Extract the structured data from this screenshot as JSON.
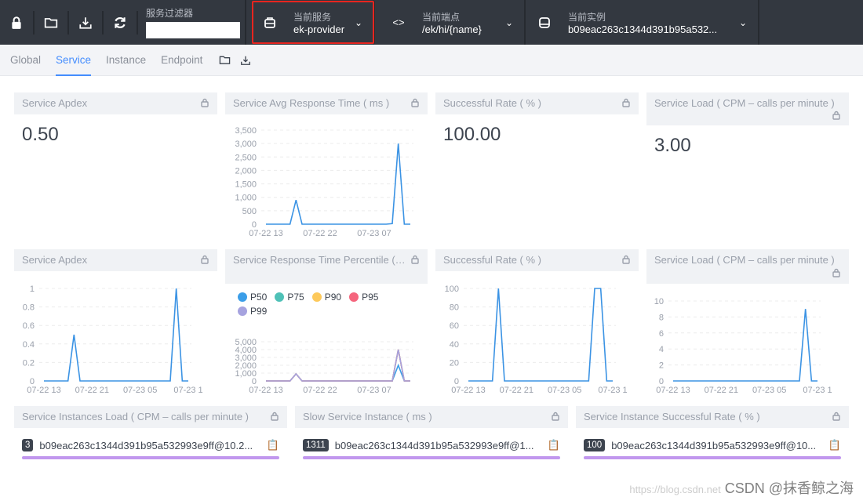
{
  "header": {
    "filter_label": "服务过滤器",
    "filter_value": "",
    "service": {
      "label": "当前服务",
      "value": "ek-provider"
    },
    "endpoint": {
      "label": "当前端点",
      "value": "/ek/hi/{name}"
    },
    "instance": {
      "label": "当前实例",
      "value": "b09eac263c1344d391b95a532..."
    },
    "icons": [
      "lock-icon",
      "folder-icon",
      "download-icon",
      "refresh-icon"
    ]
  },
  "tabs": [
    "Global",
    "Service",
    "Instance",
    "Endpoint"
  ],
  "active_tab": "Service",
  "cards": {
    "apdex": {
      "title": "Service Apdex",
      "value": "0.50"
    },
    "avg_rt": {
      "title": "Service Avg Response Time ( ms )"
    },
    "success": {
      "title": "Successful Rate ( % )",
      "value": "100.00"
    },
    "load": {
      "title": "Service Load ( CPM – calls per minute )",
      "value": "3.00"
    },
    "apdex2": {
      "title": "Service Apdex"
    },
    "percentile": {
      "title": "Service Response Time Percentile ( ms )"
    },
    "success2": {
      "title": "Successful Rate ( % )"
    },
    "load2": {
      "title": "Service Load ( CPM – calls per minute )"
    },
    "inst_load": {
      "title": "Service Instances Load ( CPM – calls per minute )",
      "badge": "3",
      "name": "b09eac263c1344d391b95a532993e9ff@10.2..."
    },
    "slow_inst": {
      "title": "Slow Service Instance ( ms )",
      "badge": "1311",
      "name": "b09eac263c1344d391b95a532993e9ff@1..."
    },
    "inst_success": {
      "title": "Service Instance Successful Rate ( % )",
      "badge": "100",
      "name": "b09eac263c1344d391b95a532993e9ff@10..."
    }
  },
  "chart_data": [
    {
      "id": "avg_rt",
      "type": "line",
      "ylim": [
        0,
        3500
      ],
      "yticks": [
        "0",
        "500",
        "1,000",
        "1,500",
        "2,000",
        "2,500",
        "3,000",
        "3,500"
      ],
      "ytickvals": [
        0,
        500,
        1000,
        1500,
        2000,
        2500,
        3000,
        3500
      ],
      "xticks": [
        {
          "i": 0,
          "label": "07-22 13"
        },
        {
          "i": 9,
          "label": "07-22 22"
        },
        {
          "i": 18,
          "label": "07-23 07"
        }
      ],
      "series": [
        {
          "color": "#3b93e4",
          "values": [
            0,
            0,
            0,
            0,
            0,
            900,
            0,
            0,
            0,
            0,
            0,
            0,
            0,
            0,
            0,
            0,
            0,
            0,
            0,
            0,
            0,
            20,
            3000,
            0,
            0
          ]
        }
      ]
    },
    {
      "id": "apdex2",
      "type": "line",
      "ylim": [
        0,
        1
      ],
      "yticks": [
        "0",
        "0.2",
        "0.4",
        "0.6",
        "0.8",
        "1"
      ],
      "ytickvals": [
        0,
        0.2,
        0.4,
        0.6,
        0.8,
        1
      ],
      "xticks": [
        {
          "i": 0,
          "label": "07-22 13"
        },
        {
          "i": 8,
          "label": "07-22 21"
        },
        {
          "i": 16,
          "label": "07-23 05"
        },
        {
          "i": 24,
          "label": "07-23 1"
        }
      ],
      "series": [
        {
          "color": "#3b93e4",
          "values": [
            0,
            0,
            0,
            0,
            0,
            0.5,
            0,
            0,
            0,
            0,
            0,
            0,
            0,
            0,
            0,
            0,
            0,
            0,
            0,
            0,
            0,
            0,
            1,
            0,
            0
          ]
        }
      ]
    },
    {
      "id": "percentile",
      "type": "line",
      "ylim": [
        0,
        5000
      ],
      "yticks": [
        "0",
        "1,000",
        "2,000",
        "3,000",
        "4,000",
        "5,000"
      ],
      "ytickvals": [
        0,
        1000,
        2000,
        3000,
        4000,
        5000
      ],
      "xticks": [
        {
          "i": 0,
          "label": "07-22 13"
        },
        {
          "i": 9,
          "label": "07-22 22"
        },
        {
          "i": 18,
          "label": "07-23 07"
        }
      ],
      "series": [
        {
          "name": "P50",
          "color": "#3b9ee8",
          "values": [
            0,
            0,
            0,
            0,
            0,
            900,
            0,
            0,
            0,
            0,
            0,
            0,
            0,
            0,
            0,
            0,
            0,
            0,
            0,
            0,
            0,
            0,
            2000,
            0,
            0
          ]
        },
        {
          "name": "P75",
          "color": "#4fc1b7",
          "values": [
            0,
            0,
            0,
            0,
            0,
            900,
            0,
            0,
            0,
            0,
            0,
            0,
            0,
            0,
            0,
            0,
            0,
            0,
            0,
            0,
            0,
            0,
            4000,
            0,
            0
          ]
        },
        {
          "name": "P90",
          "color": "#fdc95b",
          "values": [
            0,
            0,
            0,
            0,
            0,
            900,
            0,
            0,
            0,
            0,
            0,
            0,
            0,
            0,
            0,
            0,
            0,
            0,
            0,
            0,
            0,
            0,
            4000,
            0,
            0
          ]
        },
        {
          "name": "P95",
          "color": "#f5657d",
          "values": [
            0,
            0,
            0,
            0,
            0,
            900,
            0,
            0,
            0,
            0,
            0,
            0,
            0,
            0,
            0,
            0,
            0,
            0,
            0,
            0,
            0,
            0,
            4000,
            0,
            0
          ]
        },
        {
          "name": "P99",
          "color": "#a6a3df",
          "values": [
            0,
            0,
            0,
            0,
            0,
            900,
            0,
            0,
            0,
            0,
            0,
            0,
            0,
            0,
            0,
            0,
            0,
            0,
            0,
            0,
            0,
            0,
            4000,
            0,
            0
          ]
        }
      ]
    },
    {
      "id": "success2",
      "type": "line",
      "ylim": [
        0,
        100
      ],
      "yticks": [
        "0",
        "20",
        "40",
        "60",
        "80",
        "100"
      ],
      "ytickvals": [
        0,
        20,
        40,
        60,
        80,
        100
      ],
      "xticks": [
        {
          "i": 0,
          "label": "07-22 13"
        },
        {
          "i": 8,
          "label": "07-22 21"
        },
        {
          "i": 16,
          "label": "07-23 05"
        },
        {
          "i": 24,
          "label": "07-23 1"
        }
      ],
      "series": [
        {
          "color": "#3b93e4",
          "values": [
            0,
            0,
            0,
            0,
            0,
            100,
            0,
            0,
            0,
            0,
            0,
            0,
            0,
            0,
            0,
            0,
            0,
            0,
            0,
            0,
            0,
            100,
            100,
            0,
            0
          ]
        }
      ]
    },
    {
      "id": "load2",
      "type": "line",
      "ylim": [
        0,
        10
      ],
      "yticks": [
        "0",
        "2",
        "4",
        "6",
        "8",
        "10"
      ],
      "ytickvals": [
        0,
        2,
        4,
        6,
        8,
        10
      ],
      "xticks": [
        {
          "i": 0,
          "label": "07-22 13"
        },
        {
          "i": 8,
          "label": "07-22 21"
        },
        {
          "i": 16,
          "label": "07-23 05"
        },
        {
          "i": 24,
          "label": "07-23 1"
        }
      ],
      "series": [
        {
          "color": "#3b93e4",
          "values": [
            0,
            0,
            0,
            0,
            0,
            0,
            0,
            0,
            0,
            0,
            0,
            0,
            0,
            0,
            0,
            0,
            0,
            0,
            0,
            0,
            0,
            0,
            9,
            0,
            0
          ]
        }
      ]
    }
  ],
  "watermark": {
    "url": "https://blog.csdn.net",
    "text": "CSDN @抹香鲸之海"
  }
}
